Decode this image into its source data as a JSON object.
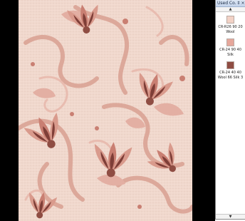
{
  "panel": {
    "title": "Used Co...",
    "pin_glyph": "‡",
    "close_glyph": "×",
    "scroll_up_glyph": "▲",
    "scroll_down_glyph": "▼"
  },
  "colors": [
    {
      "code": "CR-R26 90 20",
      "material": "Wool",
      "hex": "#f2d2c6"
    },
    {
      "code": "CR-24 90 40",
      "material": "Silk",
      "hex": "#e6a79b"
    },
    {
      "code": "CR-24 40 40",
      "material": "Wool 66 Silk 3",
      "hex": "#8f4d43"
    }
  ],
  "icons": {
    "pin": "pin-icon",
    "close": "close-icon",
    "scroll_up": "arrow-up-icon",
    "scroll_down": "arrow-down-icon"
  }
}
